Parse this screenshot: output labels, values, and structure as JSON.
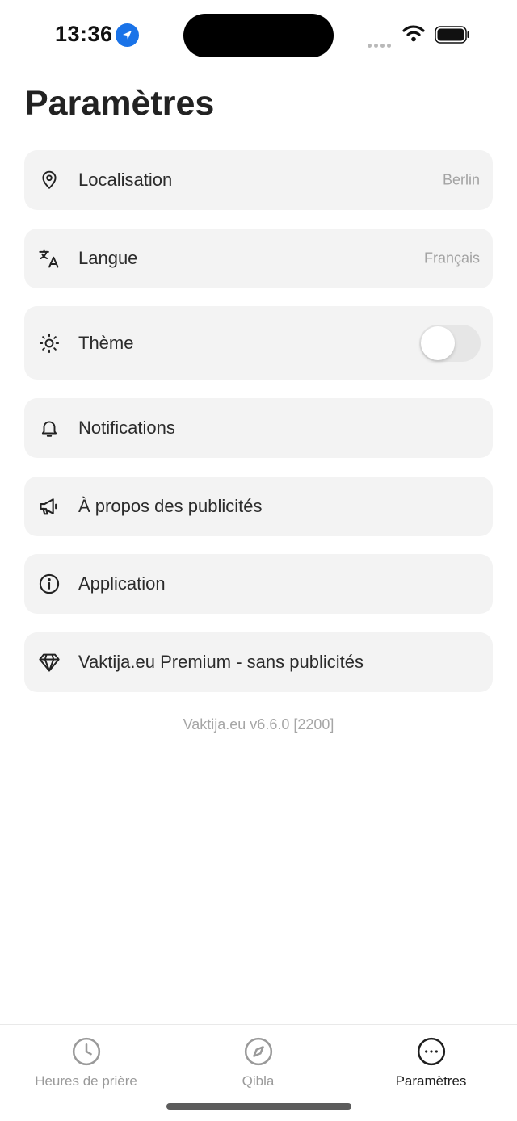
{
  "status_bar": {
    "time": "13:36"
  },
  "page": {
    "title": "Paramètres"
  },
  "settings": [
    {
      "label": "Localisation",
      "value": "Berlin",
      "icon": "location-pin-icon"
    },
    {
      "label": "Langue",
      "value": "Français",
      "icon": "translate-icon"
    },
    {
      "label": "Thème",
      "icon": "sun-icon",
      "toggle_on": false
    },
    {
      "label": "Notifications",
      "icon": "bell-icon"
    },
    {
      "label": "À propos des publicités",
      "icon": "megaphone-icon"
    },
    {
      "label": "Application",
      "icon": "info-icon"
    },
    {
      "label": "Vaktija.eu Premium - sans publicités",
      "icon": "diamond-icon"
    }
  ],
  "footer": {
    "version": "Vaktija.eu v6.6.0 [2200]"
  },
  "tabs": [
    {
      "label": "Heures de prière",
      "icon": "clock-icon",
      "active": false
    },
    {
      "label": "Qibla",
      "icon": "compass-icon",
      "active": false
    },
    {
      "label": "Paramètres",
      "icon": "more-icon",
      "active": true
    }
  ],
  "colors": {
    "row_bg": "#f3f3f3",
    "accent": "#1a73e8",
    "muted": "#a3a3a3"
  }
}
